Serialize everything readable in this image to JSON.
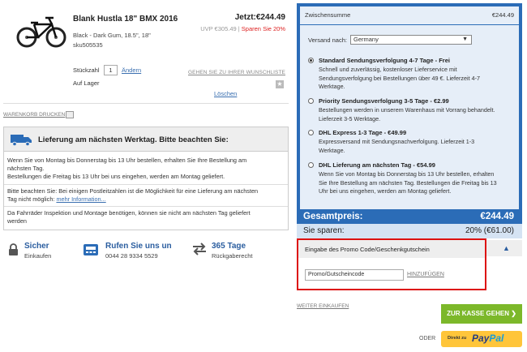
{
  "product": {
    "name": "Blank Hustla 18\" BMX 2016",
    "variant": "Black - Dark Gum, 18.5\", 18\"",
    "sku": "sku505535",
    "price": "Jetzt:€244.49",
    "uvp": "UVP €305.49 | ",
    "savings_badge": "Sparen Sie 20%",
    "quantity_label": "Stückzahl",
    "quantity_value": "1",
    "change_link": "Ändern",
    "stock": "Auf Lager",
    "wishlist_link": "GEHEN SIE ZU IHRER WUNSCHLISTE",
    "remove_link": "Löschen",
    "image_icon": "bmx-bike-image",
    "wishlist_icon": "star-icon"
  },
  "print_cart": {
    "label": "WARENKORB DRUCKEN",
    "icon": "printer-icon"
  },
  "delivery": {
    "icon": "truck-icon",
    "title": "Lieferung am nächsten Werktag. Bitte beachten Sie:",
    "para1_line1": "Wenn Sie von Montag bis Donnerstag bis 13 Uhr bestellen, erhalten Sie Ihre Bestellung am",
    "para1_line2": "nächsten Tag.",
    "para1_line3": "Bestellungen die Freitag bis 13 Uhr bei uns eingehen, werden am Montag geliefert.",
    "para2_line1": "Bitte beachten Sie: Bei einigen Postleitzahlen ist die Möglichkeit für eine Lieferung am nächsten",
    "para2_line2": "Tag nicht möglich: ",
    "para2_link": "mehr Information...",
    "para3_line1": "Da Fahrräder Inspektion und Montage benötigen, können sie nicht am nächsten Tag geliefert",
    "para3_line2": "werden"
  },
  "features": [
    {
      "icon": "lock-icon",
      "title": "Sicher",
      "subtitle": "Einkaufen"
    },
    {
      "icon": "phone-icon",
      "title": "Rufen Sie uns un",
      "subtitle": "0044 28 9334 5529"
    },
    {
      "icon": "return-arrows-icon",
      "title": "365 Tage",
      "subtitle": "Rückgaberecht"
    }
  ],
  "summary": {
    "subtotal_label": "Zwischensumme",
    "subtotal_value": "€244.49",
    "shipping_label": "Versand nach:",
    "shipping_country": "Germany",
    "options": [
      {
        "title": "Standard Sendungsverfolgung 4-7 Tage - Frei",
        "desc_1": "Schnell und zuverlässig, kostenloser Lieferservice mit",
        "desc_2": "Sendungsverfolgung bei Bestellungen über 49 €. Lieferzeit 4-7",
        "desc_3": "Werktage.",
        "selected": true
      },
      {
        "title": "Priority Sendungsverfolgung 3-5 Tage - €2.99",
        "desc_1": "Bestellungen werden in unserem Warenhaus mit Vorrang behandelt.",
        "desc_2": "Lieferzeit 3-5 Werktage.",
        "selected": false
      },
      {
        "title": "DHL Express 1-3 Tage - €49.99",
        "desc_1": "Expressversand mit Sendungsnachverfolgung. Lieferzeit 1-3",
        "desc_2": "Werktage.",
        "selected": false
      },
      {
        "title": "DHL Lieferung am nächsten Tag - €54.99",
        "desc_1": "Wenn Sie von Montag bis Donnerstag bis 13 Uhr bestellen, erhalten",
        "desc_2": "Sie Ihre Bestellung am nächsten Tag.  Bestellungen die Freitag bis 13",
        "desc_3": "Uhr bei uns eingehen,  werden am Montag geliefert.",
        "selected": false
      }
    ],
    "total_label": "Gesamtpreis:",
    "total_value": "€244.49",
    "save_label": "Sie sparen:",
    "save_value": "20% (€61.00)"
  },
  "promo": {
    "title": "Eingabe des Promo Code/Geschenkgutschein",
    "placeholder": "Promo/Gutscheincode",
    "apply": "HINZUFÜGEN",
    "chevron": "▲"
  },
  "actions": {
    "continue": "WEITER EINKAUFEN",
    "checkout": "ZUR KASSE GEHEN  ❯",
    "oder": "ODER",
    "paypal_direct": "Direkt zu",
    "paypal_pay": "Pay",
    "paypal_pal": "Pal"
  },
  "colors": {
    "panel_blue": "#2b6cb7",
    "checkout_green": "#7cb82a",
    "promo_red": "#dd1111",
    "paypal_yellow": "#ffc53a",
    "save_red": "#dd2222"
  }
}
